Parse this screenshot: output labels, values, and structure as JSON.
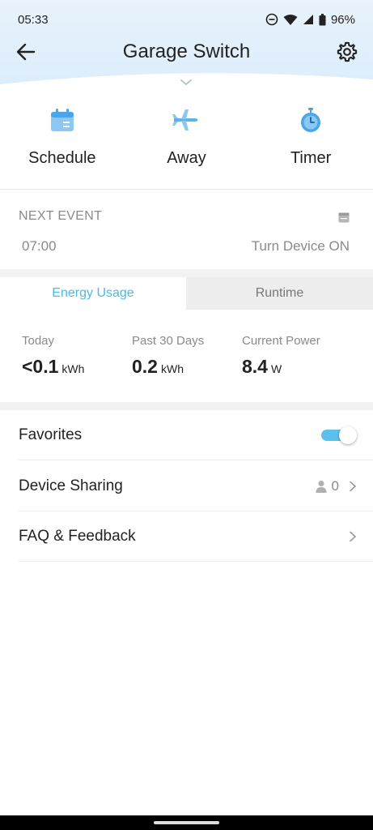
{
  "status_bar": {
    "time": "05:33",
    "battery": "96%"
  },
  "header": {
    "title": "Garage Switch"
  },
  "colors": {
    "accent": "#4bb8e6",
    "header_bg": "#e3f1fb",
    "toggle_on": "#5cc0ec"
  },
  "modes": [
    {
      "label": "Schedule",
      "icon": "calendar-icon"
    },
    {
      "label": "Away",
      "icon": "airplane-icon"
    },
    {
      "label": "Timer",
      "icon": "stopwatch-icon"
    }
  ],
  "next_event": {
    "title": "NEXT EVENT",
    "time": "07:00",
    "action": "Turn Device ON"
  },
  "tabs": [
    {
      "label": "Energy Usage",
      "active": true
    },
    {
      "label": "Runtime",
      "active": false
    }
  ],
  "stats": [
    {
      "label": "Today",
      "value": "<0.1",
      "unit": "kWh"
    },
    {
      "label": "Past 30 Days",
      "value": "0.2",
      "unit": "kWh"
    },
    {
      "label": "Current Power",
      "value": "8.4",
      "unit": "W"
    }
  ],
  "settings_rows": {
    "favorites": {
      "label": "Favorites",
      "toggle_on": true
    },
    "device_sharing": {
      "label": "Device Sharing",
      "count": "0"
    },
    "faq": {
      "label": "FAQ & Feedback"
    }
  }
}
